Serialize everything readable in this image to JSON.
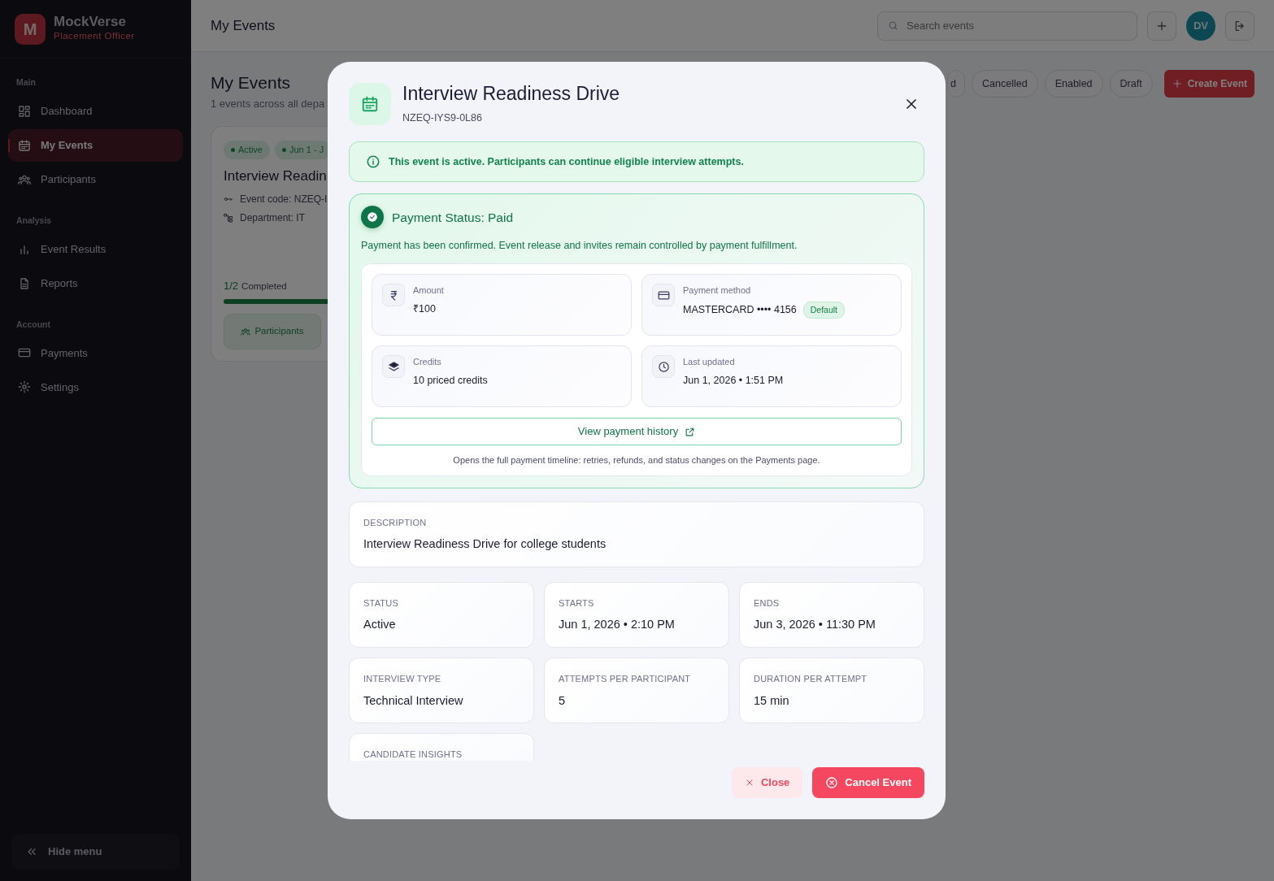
{
  "sidebar": {
    "brand": {
      "letter": "M",
      "name": "MockVerse",
      "role": "Placement Officer"
    },
    "sections": [
      {
        "title": "Main",
        "items": [
          {
            "label": "Dashboard",
            "selected": false
          },
          {
            "label": "My Events",
            "selected": true
          },
          {
            "label": "Participants",
            "selected": false
          }
        ]
      },
      {
        "title": "Analysis",
        "items": [
          {
            "label": "Event Results",
            "selected": false
          },
          {
            "label": "Reports",
            "selected": false
          }
        ]
      },
      {
        "title": "Account",
        "items": [
          {
            "label": "Payments",
            "selected": false
          },
          {
            "label": "Settings",
            "selected": false
          }
        ]
      }
    ],
    "hide_menu": "Hide menu"
  },
  "topbar": {
    "title": "My Events",
    "search": {
      "placeholder": "Search events"
    },
    "avatar": "DV"
  },
  "page": {
    "title": "My Events",
    "subtitle": "1 events across all depa",
    "filters": [
      "d",
      "Cancelled",
      "Enabled",
      "Draft"
    ],
    "create_button": "Create Event",
    "event_card": {
      "tags": [
        "Active",
        "Jun 1 - J"
      ],
      "title": "Interview Readin",
      "code": "Event code: NZEQ-I",
      "department": "Department: IT",
      "progress": {
        "count": "1/2",
        "label": "Completed",
        "level": 0.5
      },
      "button": "Participants"
    }
  },
  "modal": {
    "title": "Interview Readiness Drive",
    "code": "NZEQ-IYS9-0L86",
    "alert": "This event is active. Participants can continue eligible interview attempts.",
    "payment": {
      "title": "Payment Status: Paid",
      "text": "Payment has been confirmed. Event release and invites remain controlled by payment fulfillment.",
      "fields": [
        {
          "label": "Amount",
          "value": "₹100"
        },
        {
          "label": "Payment method",
          "value": "MASTERCARD •••• 4156",
          "badge": "Default"
        },
        {
          "label": "Credits",
          "value": "10 priced credits"
        },
        {
          "label": "Last updated",
          "value": "Jun 1, 2026 • 1:51 PM"
        }
      ],
      "history_button": "View payment history",
      "note": "Opens the full payment timeline: retries, refunds, and status changes on the Payments page."
    },
    "description": {
      "label": "DESCRIPTION",
      "value": "Interview Readiness Drive for college students"
    },
    "details": [
      {
        "label": "STATUS",
        "value": "Active"
      },
      {
        "label": "STARTS",
        "value": "Jun 1, 2026 • 2:10 PM"
      },
      {
        "label": "ENDS",
        "value": "Jun 3, 2026 • 11:30 PM"
      },
      {
        "label": "INTERVIEW TYPE",
        "value": "Technical Interview"
      },
      {
        "label": "ATTEMPTS PER PARTICIPANT",
        "value": "5"
      },
      {
        "label": "DURATION PER ATTEMPT",
        "value": "15 min"
      },
      {
        "label": "CANDIDATE INSIGHTS"
      }
    ],
    "buttons": {
      "close": "Close",
      "cancel": "Cancel Event"
    }
  }
}
